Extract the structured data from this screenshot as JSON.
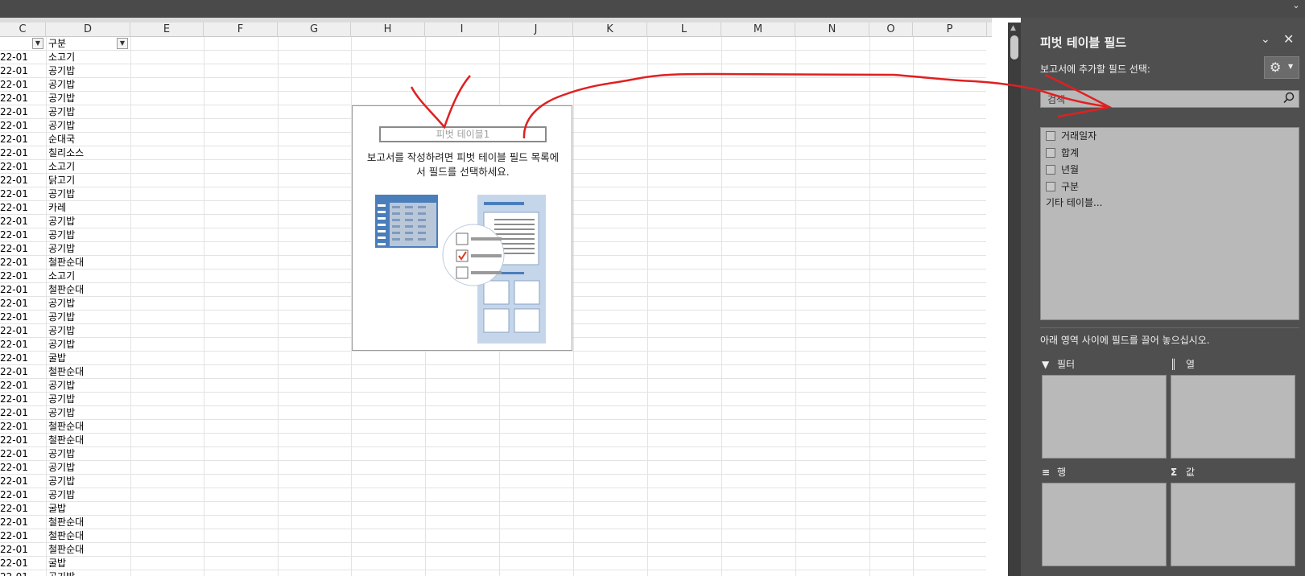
{
  "columns": [
    "C",
    "D",
    "E",
    "F",
    "G",
    "H",
    "I",
    "J",
    "K",
    "L",
    "M",
    "N",
    "O",
    "P"
  ],
  "header_row": {
    "c_label": "",
    "d_label": "구분"
  },
  "col_c_value": "22-01",
  "col_d_values": [
    "소고기",
    "공기밥",
    "공기밥",
    "공기밥",
    "공기밥",
    "공기밥",
    "순대국",
    "칠리소스",
    "소고기",
    "닭고기",
    "공기밥",
    "카레",
    "공기밥",
    "공기밥",
    "공기밥",
    "철판순대",
    "소고기",
    "철판순대",
    "공기밥",
    "공기밥",
    "공기밥",
    "공기밥",
    "굴밥",
    "철판순대",
    "공기밥",
    "공기밥",
    "공기밥",
    "철판순대",
    "철판순대",
    "공기밥",
    "공기밥",
    "공기밥",
    "공기밥",
    "굴밥",
    "철판순대",
    "철판순대",
    "철판순대",
    "굴밥",
    "공기밥"
  ],
  "pivot_placeholder": {
    "name": "피벗 테이블1",
    "message_line1": "보고서를 작성하려면 피벗 테이블 필드 목록에",
    "message_line2": "서 필드를 선택하세요."
  },
  "pane": {
    "title": "피벗 테이블 필드",
    "subtitle": "보고서에 추가할 필드 선택:",
    "search_placeholder": "검색",
    "fields": [
      "거래일자",
      "합계",
      "년월",
      "구분"
    ],
    "more_tables": "기타 테이블...",
    "drag_message": "아래 영역 사이에 필드를 끌어 놓으십시오.",
    "areas": {
      "filter": "필터",
      "columns": "열",
      "rows": "행",
      "values": "값"
    }
  },
  "colors": {
    "pane_bg": "#4f4f4f",
    "annotation": "#e02020",
    "illustration_blue": "#4a7ebb"
  }
}
